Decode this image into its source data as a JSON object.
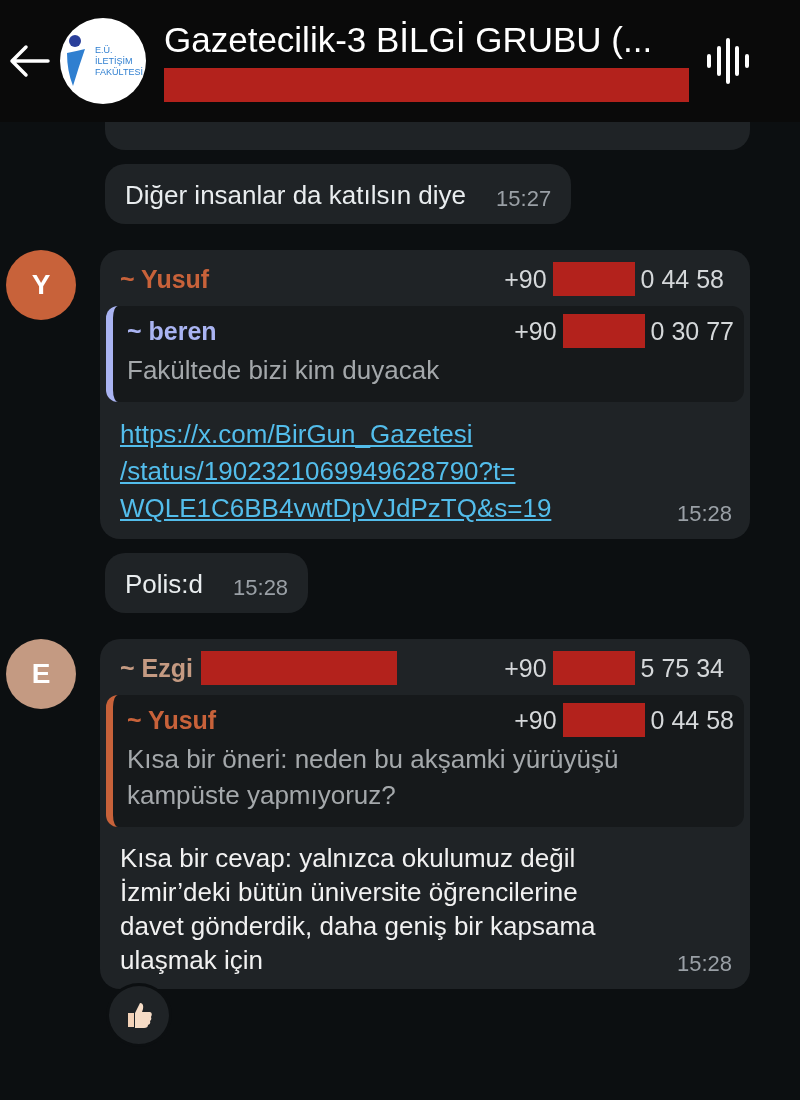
{
  "header": {
    "title": "Gazetecilik-3 BİLGİ GRUBU (...",
    "subtitle_redacted": true,
    "logo_lines": [
      "E.Ü.",
      "İLETİŞİM",
      "FAKÜLTESİ"
    ]
  },
  "messages": [
    {
      "kind": "cut"
    },
    {
      "kind": "text",
      "text": "Diğer insanlar da katılsın diye",
      "time": "15:27"
    },
    {
      "kind": "group",
      "avatar": "Y",
      "color": "#c8623a",
      "sender": "~ Yusuf",
      "name_redacted": false,
      "phone": {
        "prefix": "+90",
        "suffix": "0 44 58",
        "redacted": true
      },
      "quote": {
        "sender": "~ beren",
        "color": "#aab4f2",
        "phone": {
          "prefix": "+90",
          "suffix": "0 30 77",
          "redacted": true
        },
        "text": "Fakültede bizi kim duyacak"
      },
      "link_lines": [
        "https://x.com/BirGun_Gazetesi",
        "/status/1902321069949628790?t=",
        "WQLE1C6BB4vwtDpVJdPzTQ&s=19"
      ],
      "time": "15:28",
      "reaction": false
    },
    {
      "kind": "text",
      "text": "Polis:d",
      "time": "15:28"
    },
    {
      "kind": "group",
      "avatar": "E",
      "color": "#c49a82",
      "sender": "~ Ezgi",
      "name_redacted": true,
      "phone": {
        "prefix": "+90",
        "suffix": "5 75 34",
        "redacted": true
      },
      "quote": {
        "sender": "~ Yusuf",
        "color": "#c8623a",
        "phone": {
          "prefix": "+90",
          "suffix": "0 44 58",
          "redacted": true
        },
        "text": "Kısa bir öneri: neden bu akşamki yürüyüşü kampüste yapmıyoruz?"
      },
      "text": "Kısa bir cevap: yalnızca okulumuz değil İzmir’deki bütün üniversite öğrencilerine davet gönderdik, daha geniş bir kapsama ulaşmak için",
      "time": "15:28",
      "reaction": true
    }
  ]
}
